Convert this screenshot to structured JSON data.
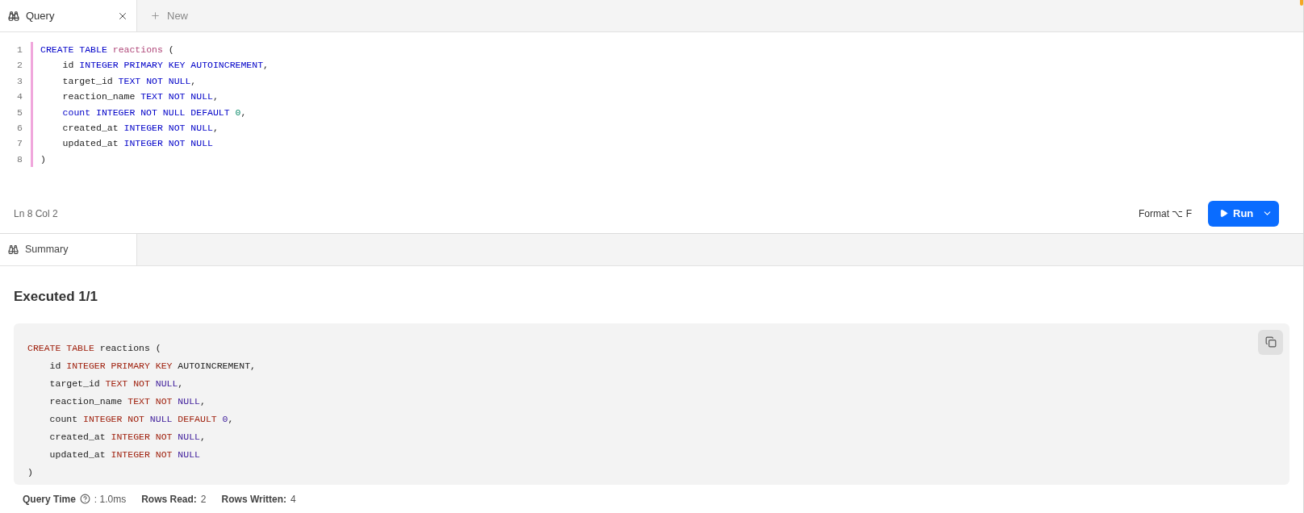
{
  "editor_tabs": [
    {
      "label": "Query",
      "selected": true,
      "closable": true
    },
    {
      "label": "New",
      "selected": false,
      "kind": "new"
    }
  ],
  "editor": {
    "lines": [
      {
        "number": "1",
        "tokens": [
          {
            "text": "CREATE TABLE",
            "kind": "keyword"
          },
          {
            "text": " reactions",
            "kind": "table"
          },
          {
            "text": " (",
            "kind": "plain"
          }
        ]
      },
      {
        "number": "2",
        "tokens": [
          {
            "text": "    id",
            "kind": "plain"
          },
          {
            "text": " INTEGER PRIMARY KEY AUTOINCREMENT",
            "kind": "keyword"
          },
          {
            "text": ",",
            "kind": "plain"
          }
        ]
      },
      {
        "number": "3",
        "tokens": [
          {
            "text": "    target_id",
            "kind": "plain"
          },
          {
            "text": " TEXT NOT NULL",
            "kind": "keyword"
          },
          {
            "text": ",",
            "kind": "plain"
          }
        ]
      },
      {
        "number": "4",
        "tokens": [
          {
            "text": "    reaction_name",
            "kind": "plain"
          },
          {
            "text": " TEXT NOT NULL",
            "kind": "keyword"
          },
          {
            "text": ",",
            "kind": "plain"
          }
        ]
      },
      {
        "number": "5",
        "tokens": [
          {
            "text": "    count INTEGER NOT NULL DEFAULT",
            "kind": "keyword"
          },
          {
            "text": " 0",
            "kind": "number"
          },
          {
            "text": ",",
            "kind": "plain"
          }
        ]
      },
      {
        "number": "6",
        "tokens": [
          {
            "text": "    created_at",
            "kind": "plain"
          },
          {
            "text": " INTEGER NOT NULL",
            "kind": "keyword"
          },
          {
            "text": ",",
            "kind": "plain"
          }
        ]
      },
      {
        "number": "7",
        "tokens": [
          {
            "text": "    updated_at",
            "kind": "plain"
          },
          {
            "text": " INTEGER NOT NULL",
            "kind": "keyword"
          }
        ]
      },
      {
        "number": "8",
        "tokens": [
          {
            "text": ")",
            "kind": "plain"
          }
        ]
      }
    ],
    "cursor": "Ln 8 Col 2",
    "format_label": "Format ⌥ F",
    "run_label": "Run"
  },
  "result_tabs": [
    {
      "label": "Summary",
      "selected": true
    }
  ],
  "summary": {
    "heading": "Executed 1/1",
    "lines": [
      {
        "tokens": [
          {
            "text": "CREATE TABLE",
            "kind": "keyword"
          },
          {
            "text": " reactions (",
            "kind": "plain"
          }
        ]
      },
      {
        "tokens": [
          {
            "text": "    id",
            "kind": "plain"
          },
          {
            "text": " INTEGER PRIMARY KEY",
            "kind": "keyword"
          },
          {
            "text": " AUTOINCREMENT,",
            "kind": "plain"
          }
        ]
      },
      {
        "tokens": [
          {
            "text": "    target_id",
            "kind": "plain"
          },
          {
            "text": " TEXT NOT",
            "kind": "keyword"
          },
          {
            "text": " NULL",
            "kind": "literal"
          },
          {
            "text": ",",
            "kind": "plain"
          }
        ]
      },
      {
        "tokens": [
          {
            "text": "    reaction_name",
            "kind": "plain"
          },
          {
            "text": " TEXT NOT",
            "kind": "keyword"
          },
          {
            "text": " NULL",
            "kind": "literal"
          },
          {
            "text": ",",
            "kind": "plain"
          }
        ]
      },
      {
        "tokens": [
          {
            "text": "    count",
            "kind": "plain"
          },
          {
            "text": " INTEGER NOT",
            "kind": "keyword"
          },
          {
            "text": " NULL",
            "kind": "literal"
          },
          {
            "text": " DEFAULT",
            "kind": "keyword"
          },
          {
            "text": " 0",
            "kind": "number"
          },
          {
            "text": ",",
            "kind": "plain"
          }
        ]
      },
      {
        "tokens": [
          {
            "text": "    created_at",
            "kind": "plain"
          },
          {
            "text": " INTEGER NOT",
            "kind": "keyword"
          },
          {
            "text": " NULL",
            "kind": "literal"
          },
          {
            "text": ",",
            "kind": "plain"
          }
        ]
      },
      {
        "tokens": [
          {
            "text": "    updated_at",
            "kind": "plain"
          },
          {
            "text": " INTEGER NOT",
            "kind": "keyword"
          },
          {
            "text": " NULL",
            "kind": "literal"
          }
        ]
      },
      {
        "tokens": [
          {
            "text": ")",
            "kind": "plain"
          }
        ]
      }
    ],
    "stats": [
      {
        "label": "Query Time",
        "help": true,
        "value": ": 1.0ms"
      },
      {
        "label": "Rows Read:",
        "help": false,
        "value": "2"
      },
      {
        "label": "Rows Written:",
        "help": false,
        "value": "4"
      }
    ]
  }
}
